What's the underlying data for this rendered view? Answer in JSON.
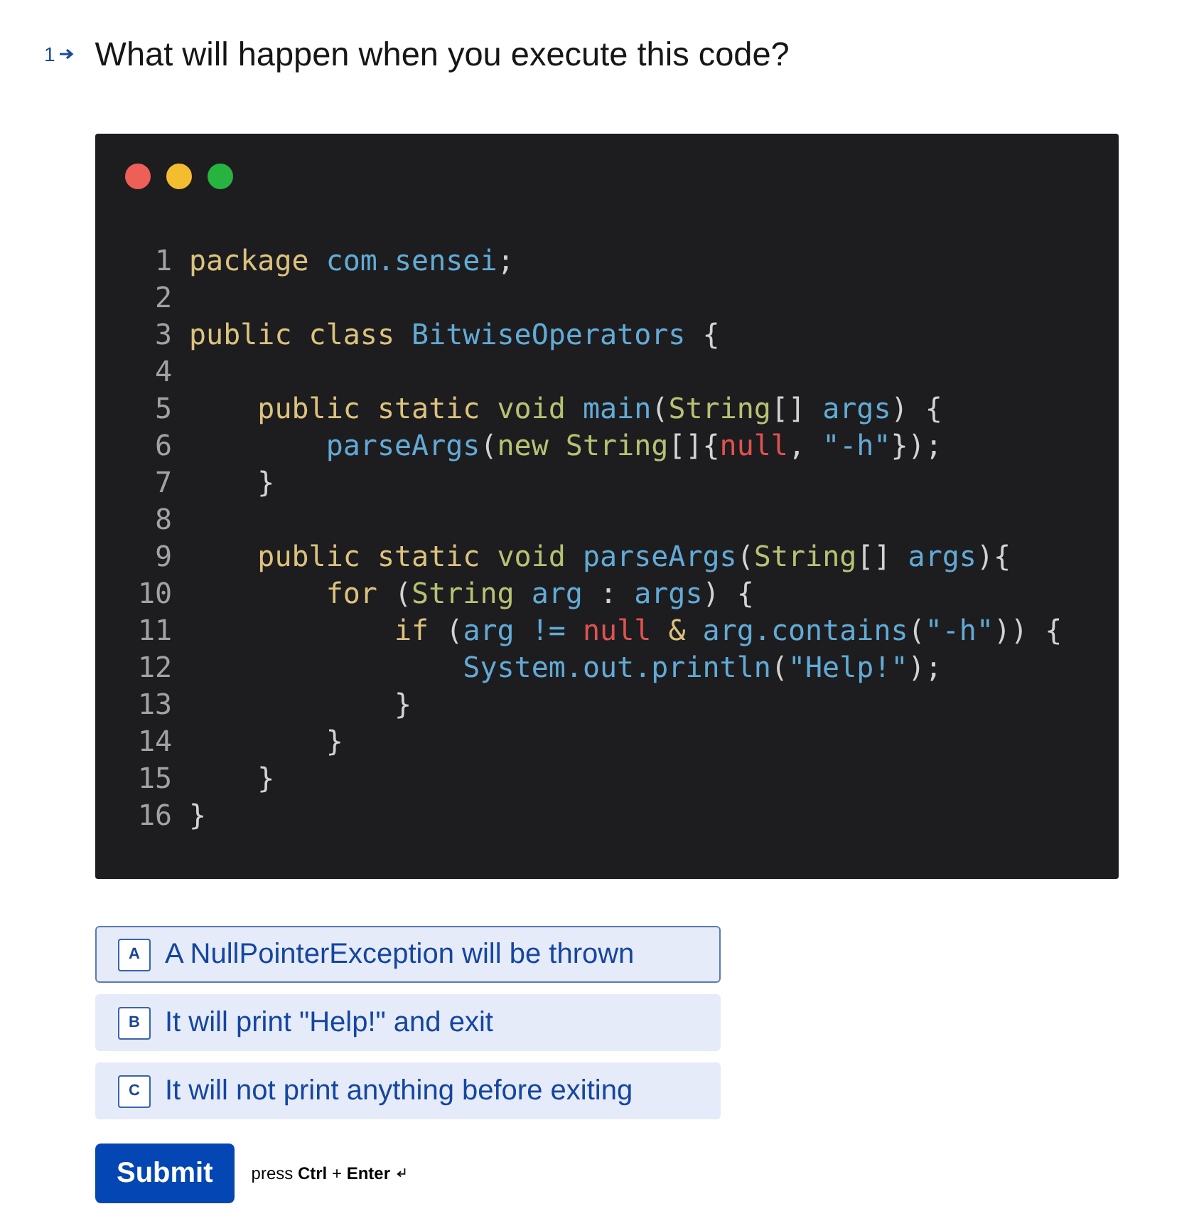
{
  "question": {
    "number": "1",
    "text": "What will happen when you execute this code?"
  },
  "code_window": {
    "lines": [
      {
        "number": "1",
        "tokens": [
          {
            "kind": "keyword",
            "text": "package"
          },
          {
            "kind": "ident",
            "text": " com.sensei"
          },
          {
            "kind": "plain",
            "text": ";"
          }
        ]
      },
      {
        "number": "2"
      },
      {
        "number": "3",
        "tokens": [
          {
            "kind": "keyword",
            "text": "public class"
          },
          {
            "kind": "ident",
            "text": " BitwiseOperators"
          },
          {
            "kind": "plain",
            "text": " {"
          }
        ]
      },
      {
        "number": "4"
      },
      {
        "number": "5",
        "tokens": [
          {
            "kind": "keyword",
            "text": "    public static"
          },
          {
            "kind": "type",
            "text": " void"
          },
          {
            "kind": "ident",
            "text": " main"
          },
          {
            "kind": "plain",
            "text": "("
          },
          {
            "kind": "type",
            "text": "String"
          },
          {
            "kind": "plain",
            "text": "[] "
          },
          {
            "kind": "ident",
            "text": "args"
          },
          {
            "kind": "plain",
            "text": ") {"
          }
        ]
      },
      {
        "number": "6",
        "tokens": [
          {
            "kind": "ident",
            "text": "        parseArgs"
          },
          {
            "kind": "plain",
            "text": "("
          },
          {
            "kind": "type",
            "text": "new String"
          },
          {
            "kind": "plain",
            "text": "[]{"
          },
          {
            "kind": "null",
            "text": "null"
          },
          {
            "kind": "plain",
            "text": ", "
          },
          {
            "kind": "ident",
            "text": "\"-h\""
          },
          {
            "kind": "plain",
            "text": "});"
          }
        ]
      },
      {
        "number": "7",
        "tokens": [
          {
            "kind": "plain",
            "text": "    }"
          }
        ]
      },
      {
        "number": "8"
      },
      {
        "number": "9",
        "tokens": [
          {
            "kind": "keyword",
            "text": "    public static"
          },
          {
            "kind": "type",
            "text": " void"
          },
          {
            "kind": "ident",
            "text": " parseArgs"
          },
          {
            "kind": "plain",
            "text": "("
          },
          {
            "kind": "type",
            "text": "String"
          },
          {
            "kind": "plain",
            "text": "[] "
          },
          {
            "kind": "ident",
            "text": "args"
          },
          {
            "kind": "plain",
            "text": "){"
          }
        ]
      },
      {
        "number": "10",
        "tokens": [
          {
            "kind": "keyword",
            "text": "        for"
          },
          {
            "kind": "plain",
            "text": " ("
          },
          {
            "kind": "type",
            "text": "String"
          },
          {
            "kind": "ident",
            "text": " arg"
          },
          {
            "kind": "plain",
            "text": " : "
          },
          {
            "kind": "ident",
            "text": "args"
          },
          {
            "kind": "plain",
            "text": ") {"
          }
        ]
      },
      {
        "number": "11",
        "tokens": [
          {
            "kind": "keyword",
            "text": "            if"
          },
          {
            "kind": "plain",
            "text": " ("
          },
          {
            "kind": "ident",
            "text": "arg != "
          },
          {
            "kind": "null",
            "text": "null"
          },
          {
            "kind": "keyword",
            "text": " &"
          },
          {
            "kind": "ident",
            "text": " arg.contains"
          },
          {
            "kind": "plain",
            "text": "("
          },
          {
            "kind": "ident",
            "text": "\"-h\""
          },
          {
            "kind": "plain",
            "text": ")) {"
          }
        ]
      },
      {
        "number": "12",
        "tokens": [
          {
            "kind": "ident",
            "text": "                System.out.println"
          },
          {
            "kind": "plain",
            "text": "("
          },
          {
            "kind": "ident",
            "text": "\"Help!\""
          },
          {
            "kind": "plain",
            "text": ");"
          }
        ]
      },
      {
        "number": "13",
        "tokens": [
          {
            "kind": "plain",
            "text": "            }"
          }
        ]
      },
      {
        "number": "14",
        "tokens": [
          {
            "kind": "plain",
            "text": "        }"
          }
        ]
      },
      {
        "number": "15",
        "tokens": [
          {
            "kind": "plain",
            "text": "    }"
          }
        ]
      },
      {
        "number": "16",
        "tokens": [
          {
            "kind": "plain",
            "text": "}"
          }
        ]
      }
    ]
  },
  "options": [
    {
      "letter": "A",
      "text": "A NullPointerException will be thrown",
      "selected": true
    },
    {
      "letter": "B",
      "text": "It will print \"Help!\" and exit",
      "selected": false
    },
    {
      "letter": "C",
      "text": "It will not print anything before exiting",
      "selected": false
    }
  ],
  "submit": {
    "label": "Submit",
    "hint": "press **Ctrl** + **Enter**"
  }
}
